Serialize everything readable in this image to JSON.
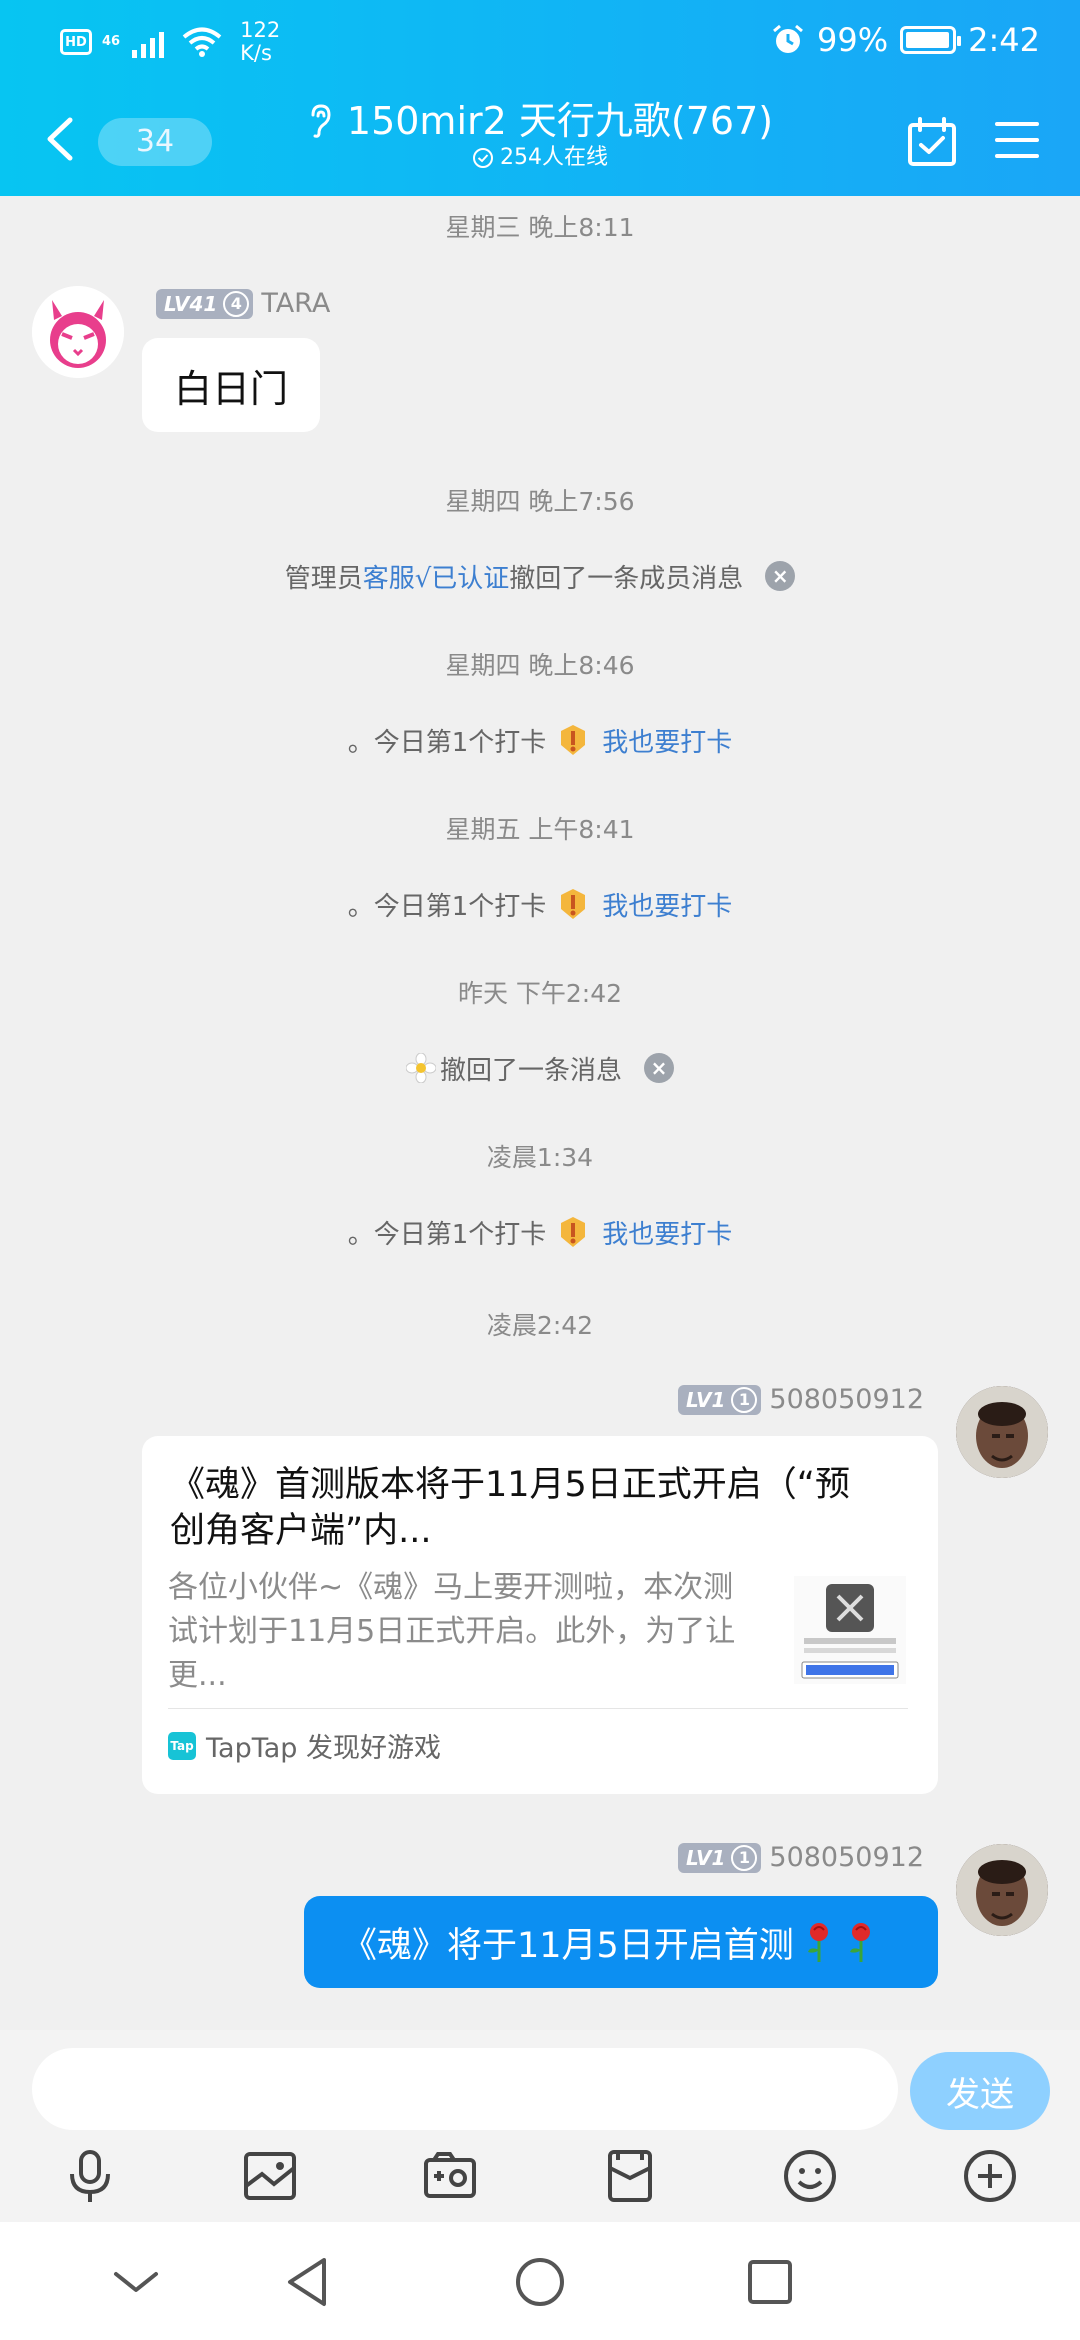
{
  "status_bar": {
    "hd": "HD",
    "network": "46",
    "speed_value": "122",
    "speed_unit": "K/s",
    "battery": "99%",
    "time": "2:42"
  },
  "header": {
    "unread_count": "34",
    "group_name": "150mir2 天行九歌(767)",
    "online": "254人在线"
  },
  "chat": {
    "timestamps": [
      "星期三 晚上8:11",
      "星期四 晚上7:56",
      "星期四 晚上8:46",
      "星期五 上午8:41",
      "昨天 下午2:42",
      "凌晨1:34",
      "凌晨2:42"
    ],
    "msg1": {
      "level": "LV41",
      "level_num": "4",
      "sender": "TARA",
      "text": "白日门"
    },
    "recall_admin": {
      "prefix": "管理员",
      "admin": "客服√已认证",
      "suffix": "撤回了一条成员消息"
    },
    "checkin": {
      "text": "。今日第1个打卡",
      "action": "我也要打卡"
    },
    "recall_self": "撤回了一条消息",
    "msg2": {
      "level": "LV1",
      "level_num": "1",
      "sender": "508050912",
      "card_title": "《魂》首测版本将于11月5日正式开启（“预创角客户端”内...",
      "card_desc": "各位小伙伴~《魂》马上要开测啦，本次测试计划于11月5日正式开启。此外，为了让更...",
      "card_source_icon": "Tap",
      "card_source": "TapTap 发现好游戏"
    },
    "msg3": {
      "level": "LV1",
      "level_num": "1",
      "sender": "508050912",
      "text": "《魂》将于11月5日开启首测"
    }
  },
  "input": {
    "placeholder": "",
    "send_label": "发送"
  },
  "colors": {
    "header_start": "#07c5f2",
    "header_end": "#1aa6f7",
    "link": "#3d7fd0",
    "bubble_blue": "#0c8ff2",
    "send_button": "#8ed0ff"
  }
}
